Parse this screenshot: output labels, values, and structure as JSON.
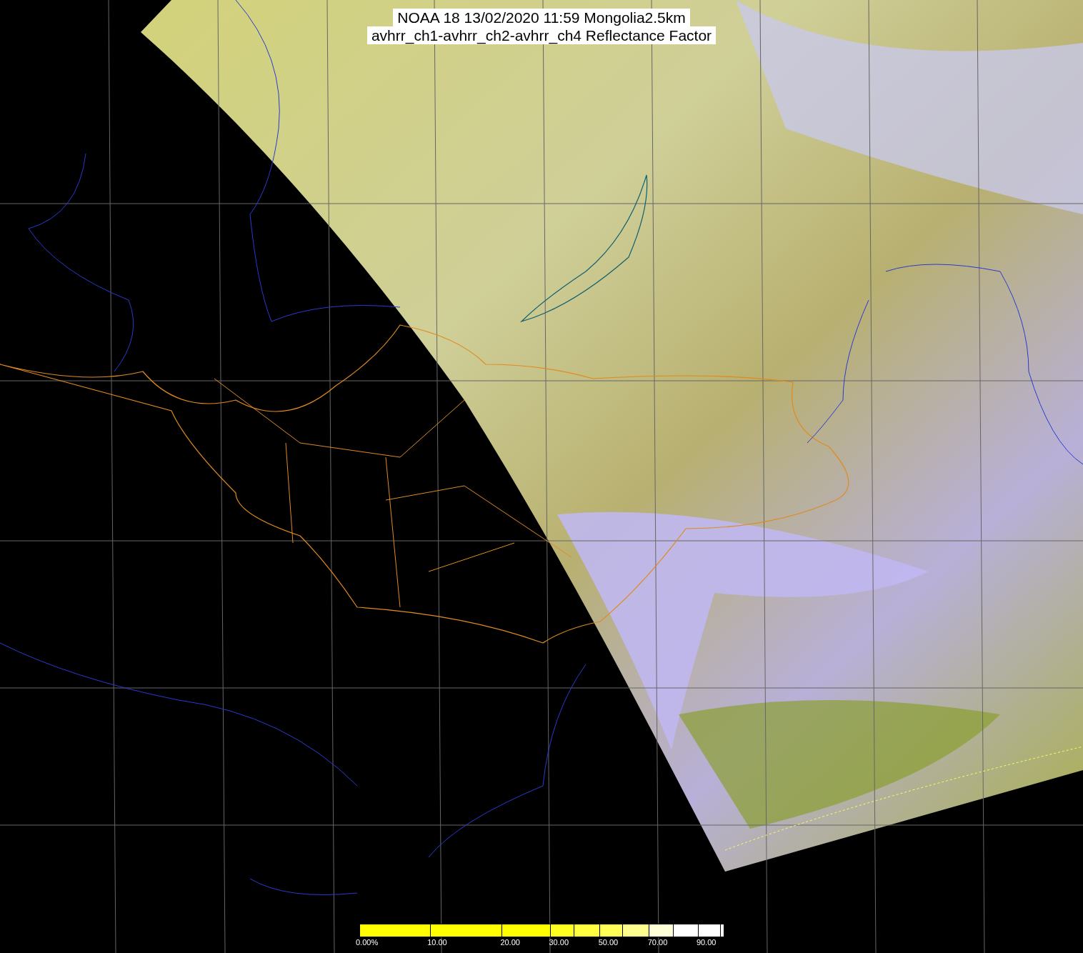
{
  "title_lines": [
    "NOAA 18 13/02/2020 11:59 Mongolia2.5km",
    "avhrr_ch1-avhrr_ch2-avhrr_ch4 Reflectance Factor"
  ],
  "legend": {
    "segments": [
      {
        "color": "#ffff00",
        "label": "0.00%"
      },
      {
        "color": "#ffff00",
        "label": "10.00"
      },
      {
        "color": "#ffff00",
        "label": "20.00"
      },
      {
        "color": "#ffff20",
        "label": "30.00"
      },
      {
        "color": "#ffff40"
      },
      {
        "color": "#ffff58",
        "label": "50.00"
      },
      {
        "color": "#ffff90"
      },
      {
        "color": "#ffffd8",
        "label": "70.00"
      },
      {
        "color": "#ffffff"
      },
      {
        "color": "#ffffff",
        "label": "90.00"
      },
      {
        "color": "#ffffff"
      }
    ]
  }
}
